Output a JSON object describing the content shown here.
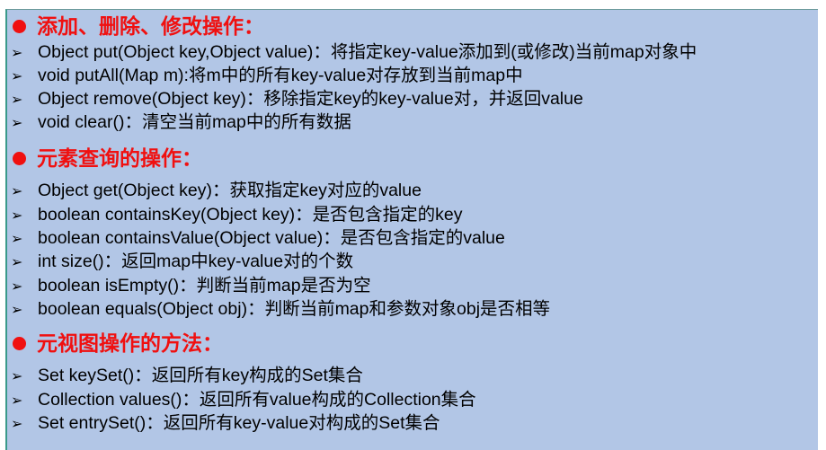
{
  "sections": [
    {
      "title": "添加、删除、修改操作：",
      "items": [
        "Object put(Object key,Object value)：将指定key-value添加到(或修改)当前map对象中",
        "void putAll(Map m):将m中的所有key-value对存放到当前map中",
        "Object remove(Object key)：移除指定key的key-value对，并返回value",
        "void clear()：清空当前map中的所有数据"
      ]
    },
    {
      "title": "元素查询的操作：",
      "items": [
        "Object get(Object key)：获取指定key对应的value",
        "boolean containsKey(Object key)：是否包含指定的key",
        "boolean containsValue(Object value)：是否包含指定的value",
        "int size()：返回map中key-value对的个数",
        "boolean isEmpty()：判断当前map是否为空",
        "boolean equals(Object obj)：判断当前map和参数对象obj是否相等"
      ]
    },
    {
      "title": "元视图操作的方法：",
      "items": [
        "Set keySet()：返回所有key构成的Set集合",
        "Collection values()：返回所有value构成的Collection集合",
        "Set entrySet()：返回所有key-value对构成的Set集合"
      ]
    }
  ],
  "bullet_icon": "arrow-bullet-icon",
  "heading_color": "#f01010"
}
